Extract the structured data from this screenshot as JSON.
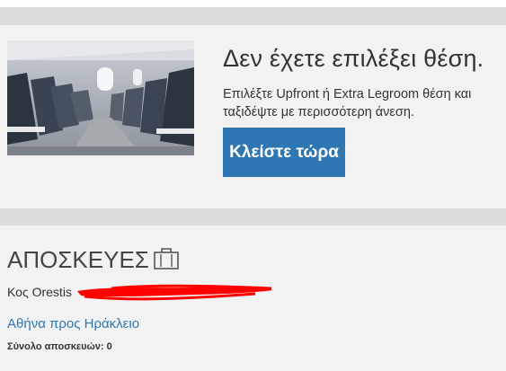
{
  "promo": {
    "title": "Δεν έχετε επιλέξει θέση.",
    "description": "Επιλέξτε Upfront ή Extra Legroom θέση και ταξιδέψτε με περισσότερη άνεση.",
    "button_label": "Κλείστε τώρα",
    "image": "airplane-cabin-seats"
  },
  "baggage": {
    "title": "ΑΠΟΣΚΕΥΕΣ",
    "icon": "suitcase-icon",
    "passenger_name": "Κος Orestis",
    "route_link": "Αθήνα προς Ηράκλειο",
    "total_label": "Σύνολο αποσκευών:",
    "total_value": "0"
  },
  "colors": {
    "accent": "#2f77b3",
    "panel": "#f2f2f2",
    "strip": "#dddddd",
    "redaction": "#ff0000"
  }
}
